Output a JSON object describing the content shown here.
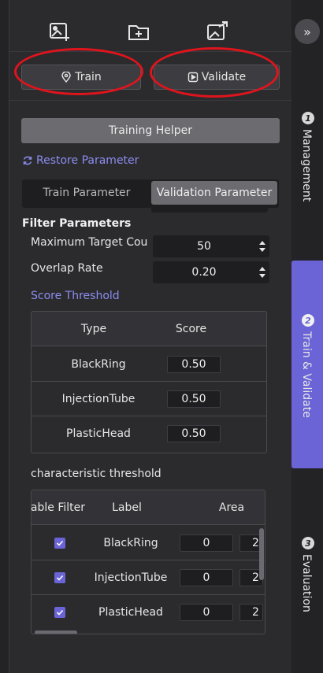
{
  "toolbar": {
    "icons": [
      "add-image-icon",
      "add-folder-icon",
      "export-image-icon"
    ],
    "collapse_glyph": "»"
  },
  "actions": {
    "train_label": "Train",
    "validate_label": "Validate"
  },
  "helper": {
    "label": "Training Helper"
  },
  "restore": {
    "label": "Restore Parameter"
  },
  "tabs": [
    {
      "label": "Train Parameter",
      "active": false
    },
    {
      "label": "Validation Parameter",
      "active": true
    }
  ],
  "filter": {
    "title": "Filter Parameters",
    "params": [
      {
        "label": "Maximum Target Count",
        "value": "50"
      },
      {
        "label": "Overlap Rate",
        "value": "0.20"
      }
    ]
  },
  "score_threshold": {
    "title": "Score Threshold",
    "headers": [
      "Type",
      "Score"
    ],
    "rows": [
      {
        "type": "BlackRing",
        "score": "0.50"
      },
      {
        "type": "InjectionTube",
        "score": "0.50"
      },
      {
        "type": "PlasticHead",
        "score": "0.50"
      }
    ]
  },
  "characteristic": {
    "title": "characteristic threshold",
    "headers": [
      "Enable Filter",
      "Label",
      "Area"
    ],
    "rows": [
      {
        "enabled": true,
        "label": "BlackRing",
        "min": "0",
        "max": "2"
      },
      {
        "enabled": true,
        "label": "InjectionTube",
        "min": "0",
        "max": "2"
      },
      {
        "enabled": true,
        "label": "PlasticHead",
        "min": "0",
        "max": "2"
      }
    ]
  },
  "sidebar": {
    "tabs": [
      {
        "num": "1",
        "label": "Management",
        "active": false
      },
      {
        "num": "2",
        "label": "Train & Validate",
        "active": true
      },
      {
        "num": "3",
        "label": "Evaluation",
        "active": false
      }
    ]
  },
  "colors": {
    "accent": "#6a64d6",
    "link": "#8c8cf0",
    "annotation": "#e0141c",
    "panel": "#2b2b2e"
  }
}
